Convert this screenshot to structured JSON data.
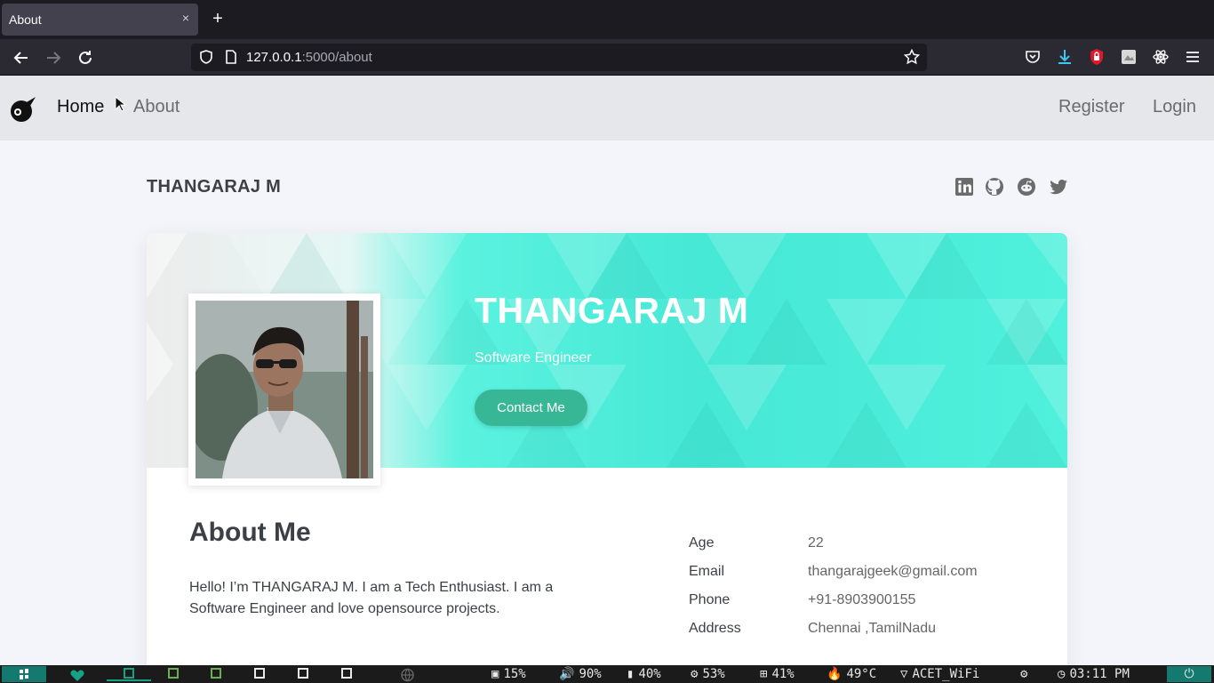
{
  "browser": {
    "tab_title": "About",
    "tab_close": "×",
    "new_tab": "+",
    "url_host": "127.0.0.1",
    "url_path": ":5000/about"
  },
  "site": {
    "nav": {
      "home": "Home",
      "about": "About",
      "register": "Register",
      "login": "Login"
    },
    "page_title": "THANGARAJ M",
    "social_icons": [
      "linkedin-icon",
      "github-icon",
      "reddit-icon",
      "twitter-icon"
    ]
  },
  "profile": {
    "name": "THANGARAJ M",
    "role": "Software Engineer",
    "contact_label": "Contact Me",
    "about_title": "About Me",
    "about_text": "Hello! I’m THANGARAJ M. I am a Tech Enthusiast. I am a Software Engineer and love opensource projects.",
    "info": [
      {
        "label": "Age",
        "value": "22"
      },
      {
        "label": "Email",
        "value": "thangarajgeek@gmail.com"
      },
      {
        "label": "Phone",
        "value": "+91-8903900155"
      },
      {
        "label": "Address",
        "value": "Chennai ,TamilNadu"
      }
    ]
  },
  "taskbar": {
    "disk": "15%",
    "volume": "90%",
    "battery": "40%",
    "cpu": "53%",
    "memory": "41%",
    "temperature": "49°C",
    "wifi": "ACET_WiFi",
    "time": "03:11 PM"
  },
  "colors": {
    "banner_teal": "#4ff0dc",
    "button": "#37b795",
    "nav_bg": "#e5e7eb"
  }
}
